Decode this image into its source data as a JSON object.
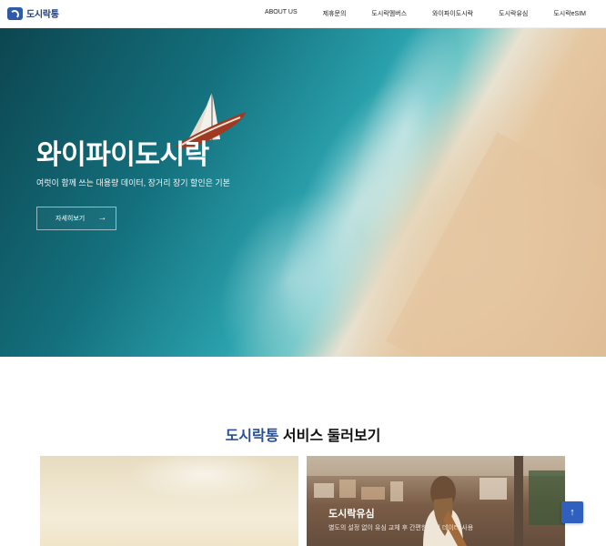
{
  "header": {
    "logo_text": "도시락통",
    "nav": [
      "ABOUT US",
      "제휴문의",
      "도시락멤버스",
      "와이파이도시락",
      "도시락유심",
      "도시락eSIM"
    ]
  },
  "hero": {
    "title": "와이파이도시락",
    "subtitle": "여럿이 함께 쓰는 대용량 데이터, 장거리 장기 할인은 기본",
    "button_label": "자세히보기",
    "button_icon": "arrow-right-icon"
  },
  "section": {
    "title_accent": "도시락통",
    "title_rest": " 서비스 둘러보기",
    "cards": [
      {
        "title": "",
        "desc": ""
      },
      {
        "title": "도시락유심",
        "desc": "별도의 설정 없이 유심 교체 후 간편한 해외 데이터 사용"
      }
    ]
  },
  "scroll_top": {
    "icon": "arrow-up-icon",
    "glyph": "↑"
  },
  "colors": {
    "brand": "#2f5aa8",
    "accent_text": "#2b4f95",
    "top_button": "#2f5fbf"
  }
}
